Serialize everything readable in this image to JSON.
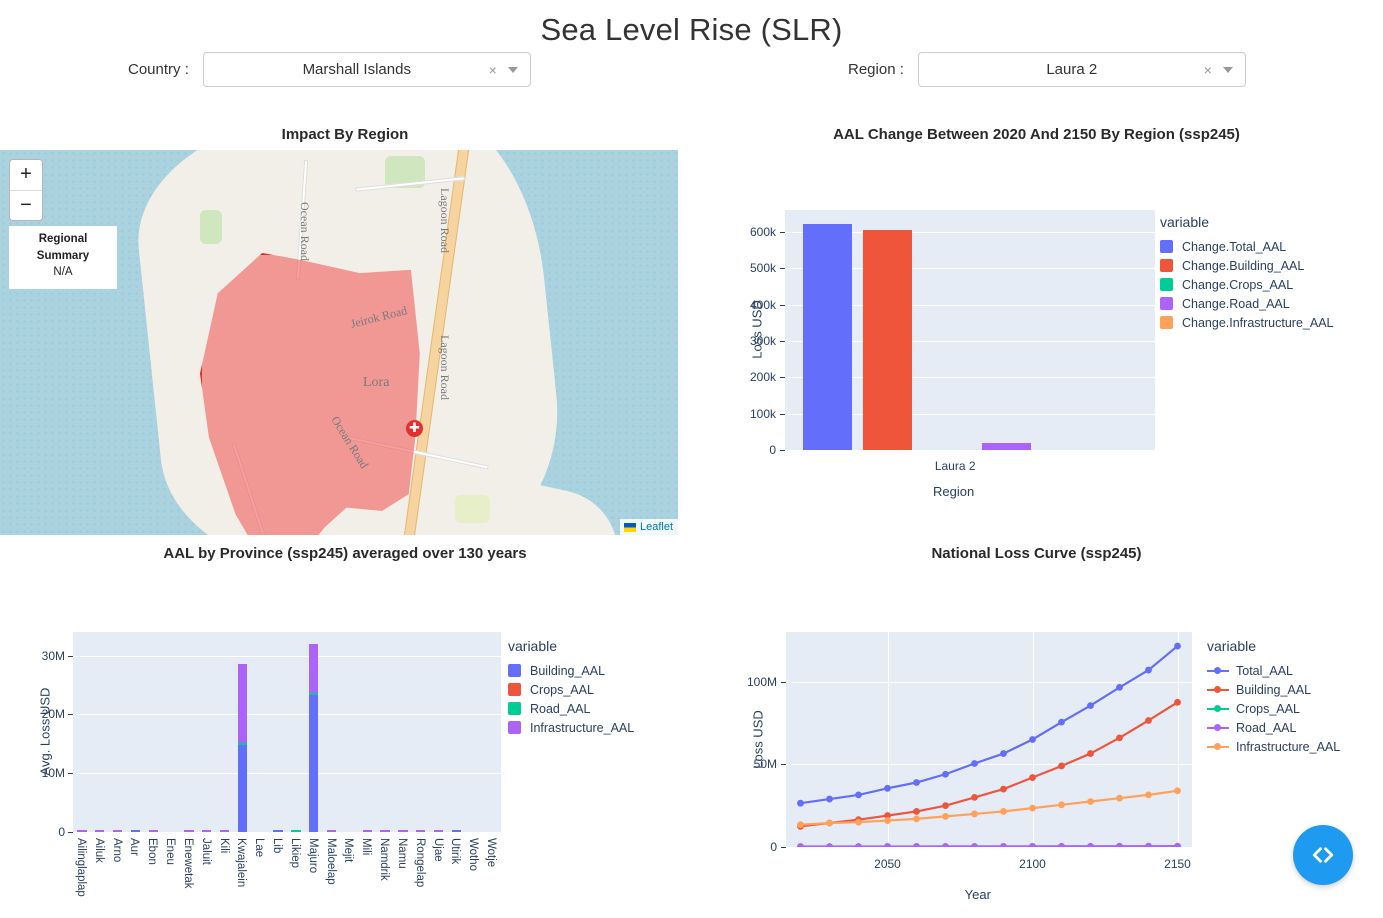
{
  "header": {
    "title": "Sea Level Rise (SLR)",
    "country_label": "Country :",
    "country_value": "Marshall Islands",
    "region_label": "Region :",
    "region_value": "Laura 2",
    "clear_glyph": "×"
  },
  "map": {
    "title": "Impact By Region",
    "zoom_in": "+",
    "zoom_out": "−",
    "summary_title": "Regional Summary",
    "summary_value": "N/A",
    "attribution": "Leaflet",
    "marker_glyph": "✚",
    "labels": [
      {
        "text": "Ocean Road"
      },
      {
        "text": "Lagoon Road"
      },
      {
        "text": "Jeirok Road"
      },
      {
        "text": "Lora"
      },
      {
        "text": "Lagoon Road"
      },
      {
        "text": "Ocean Road"
      }
    ]
  },
  "fab": {
    "icon": "code-icon",
    "glyph": "‹›"
  },
  "chart_data": [
    {
      "id": "aal-change-by-region",
      "type": "bar",
      "title": "AAL Change Between 2020 And 2150 By Region (ssp245)",
      "xlabel": "Region",
      "ylabel": "Loss USD",
      "categories": [
        "Laura 2"
      ],
      "ylim": [
        0,
        660000
      ],
      "yticks": [
        0,
        100000,
        200000,
        300000,
        400000,
        500000,
        600000
      ],
      "ytick_labels": [
        "0",
        "100k",
        "200k",
        "300k",
        "400k",
        "500k",
        "600k"
      ],
      "legend_title": "variable",
      "legend_position": "right",
      "grid": true,
      "series": [
        {
          "name": "Change.Total_AAL",
          "color": "#636EFA",
          "values": [
            622000
          ]
        },
        {
          "name": "Change.Building_AAL",
          "color": "#EF553B",
          "values": [
            604000
          ]
        },
        {
          "name": "Change.Crops_AAL",
          "color": "#00CC96",
          "values": [
            0
          ]
        },
        {
          "name": "Change.Road_AAL",
          "color": "#AB63FA",
          "values": [
            18000
          ]
        },
        {
          "name": "Change.Infrastructure_AAL",
          "color": "#FFA15A",
          "values": [
            0
          ]
        }
      ]
    },
    {
      "id": "aal-by-province",
      "type": "bar",
      "barmode": "stacked",
      "title": "AAL by Province (ssp245) averaged over 130 years",
      "xlabel": "",
      "ylabel": "Avg. Loss USD",
      "ylim": [
        0,
        34000000
      ],
      "yticks": [
        0,
        10000000,
        20000000,
        30000000
      ],
      "ytick_labels": [
        "0",
        "10M",
        "20M",
        "30M"
      ],
      "legend_title": "variable",
      "legend_position": "right",
      "grid": true,
      "categories": [
        "Ailinglaplap",
        "Ailuk",
        "Arno",
        "Aur",
        "Ebon",
        "Eneu",
        "Enewetak",
        "Jaluit",
        "Kili",
        "Kwajalein",
        "Lae",
        "Lib",
        "Likiep",
        "Majuro",
        "Maloelap",
        "Mejit",
        "Mili",
        "Namdrik",
        "Namu",
        "Rongelap",
        "Ujae",
        "Utirik",
        "Wotho",
        "Wotje"
      ],
      "series": [
        {
          "name": "Building_AAL",
          "color": "#636EFA",
          "values": [
            0,
            0,
            0,
            60000,
            0,
            0,
            0,
            0,
            0,
            14800000,
            0,
            120000,
            0,
            23300000,
            0,
            0,
            0,
            0,
            0,
            0,
            0,
            90000,
            0,
            0
          ]
        },
        {
          "name": "Crops_AAL",
          "color": "#EF553B",
          "values": [
            0,
            0,
            0,
            0,
            0,
            0,
            0,
            0,
            0,
            0,
            0,
            0,
            0,
            0,
            0,
            0,
            0,
            0,
            0,
            0,
            0,
            0,
            0,
            0
          ]
        },
        {
          "name": "Road_AAL",
          "color": "#00CC96",
          "values": [
            0,
            0,
            0,
            0,
            0,
            0,
            0,
            0,
            0,
            300000,
            0,
            0,
            180000,
            400000,
            0,
            0,
            0,
            0,
            0,
            0,
            0,
            0,
            0,
            0
          ]
        },
        {
          "name": "Infrastructure_AAL",
          "color": "#AB63FA",
          "values": [
            150000,
            130000,
            140000,
            0,
            150000,
            0,
            330000,
            200000,
            240000,
            13400000,
            0,
            0,
            0,
            8300000,
            160000,
            0,
            180000,
            210000,
            110000,
            190000,
            120000,
            0,
            0,
            0
          ]
        }
      ]
    },
    {
      "id": "national-loss-curve",
      "type": "line",
      "title": "National Loss Curve (ssp245)",
      "xlabel": "Year",
      "ylabel": "Loss USD",
      "xlim": [
        2015,
        2155
      ],
      "xticks": [
        2050,
        2100,
        2150
      ],
      "xtick_labels": [
        "2050",
        "2100",
        "2150"
      ],
      "ylim": [
        0,
        130000000
      ],
      "yticks": [
        0,
        50000000,
        100000000
      ],
      "ytick_labels": [
        "0",
        "50M",
        "100M"
      ],
      "legend_title": "variable",
      "legend_position": "right",
      "grid": true,
      "x": [
        2020,
        2030,
        2040,
        2050,
        2060,
        2070,
        2080,
        2090,
        2100,
        2110,
        2120,
        2130,
        2140,
        2150
      ],
      "series": [
        {
          "name": "Total_AAL",
          "color": "#636EFA",
          "values": [
            26500000,
            29000000,
            31500000,
            35500000,
            39000000,
            44000000,
            50500000,
            56500000,
            65000000,
            75500000,
            85500000,
            96500000,
            107000000,
            121500000
          ]
        },
        {
          "name": "Building_AAL",
          "color": "#EF553B",
          "values": [
            12500000,
            14500000,
            16500000,
            19000000,
            21500000,
            25000000,
            30000000,
            35000000,
            42000000,
            49000000,
            56500000,
            66000000,
            76500000,
            87500000
          ]
        },
        {
          "name": "Crops_AAL",
          "color": "#00CC96",
          "values": [
            100000,
            100000,
            110000,
            110000,
            120000,
            120000,
            130000,
            130000,
            140000,
            140000,
            150000,
            150000,
            160000,
            160000
          ]
        },
        {
          "name": "Road_AAL",
          "color": "#AB63FA",
          "values": [
            300000,
            310000,
            320000,
            330000,
            350000,
            360000,
            380000,
            400000,
            420000,
            440000,
            460000,
            480000,
            500000,
            520000
          ]
        },
        {
          "name": "Infrastructure_AAL",
          "color": "#FFA15A",
          "values": [
            13500000,
            14500000,
            15000000,
            16000000,
            17000000,
            18500000,
            20000000,
            21500000,
            23500000,
            25500000,
            27500000,
            29500000,
            31500000,
            34000000
          ]
        }
      ]
    }
  ]
}
